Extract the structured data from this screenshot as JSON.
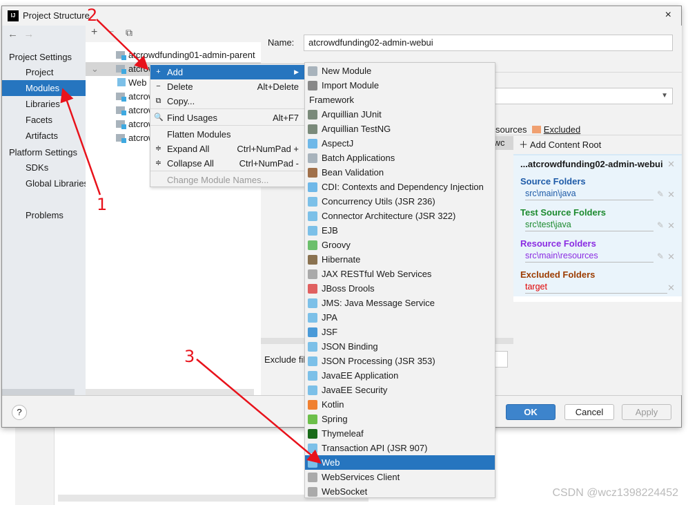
{
  "dialog": {
    "title": "Project Structure",
    "close": "×"
  },
  "sidebar": {
    "back": "←",
    "forward": "→",
    "section1": "Project Settings",
    "items1": [
      "Project",
      "Modules",
      "Libraries",
      "Facets",
      "Artifacts"
    ],
    "section2": "Platform Settings",
    "items2": [
      "SDKs",
      "Global Libraries"
    ],
    "problems": "Problems",
    "selected": "Modules"
  },
  "tree": {
    "toolbar": {
      "add": "+",
      "remove": "−",
      "copy": "⧉"
    },
    "rows": [
      "atcrowdfunding01-admin-parent",
      "atcrowdfunding02-admin-webui",
      "Web",
      "atcrowdfunding03-admin-component",
      "atcrowdfunding04-admin-entity",
      "atcrowdfunding05-common-util",
      "atcrowdfunding06-common-reverse"
    ],
    "row_visible": [
      "atcrowdfunding01-admin-parent",
      "atcrowdfunding02-admin-webui",
      "Web",
      "atcrowdf",
      "atcrowdf",
      "atcrowdf",
      "atcrowdf"
    ]
  },
  "details": {
    "name_label": "Name:",
    "name_value": "atcrowdfunding02-admin-webui",
    "legend_resources": "sources",
    "legend_excluded": "Excluded",
    "tree_partial": "rowc",
    "exclude_label": "Exclude fil"
  },
  "content_root": {
    "add": "Add Content Root",
    "path": "...atcrowdfunding02-admin-webui",
    "source_h": "Source Folders",
    "source_p": "src\\main\\java",
    "test_h": "Test Source Folders",
    "test_p": "src\\test\\java",
    "res_h": "Resource Folders",
    "res_p": "src\\main\\resources",
    "exc_h": "Excluded Folders",
    "exc_p": "target",
    "colors": {
      "source": "#1e5ba8",
      "test": "#1c8a2e",
      "res": "#8a2be2",
      "exc": "#9c3c00",
      "exc_path": "#e00000"
    }
  },
  "context_menu": [
    {
      "label": "Add",
      "shortcut": "",
      "icon": "+",
      "sel": true
    },
    {
      "label": "Delete",
      "shortcut": "Alt+Delete",
      "icon": "−"
    },
    {
      "label": "Copy...",
      "shortcut": "",
      "icon": "⧉"
    },
    {
      "label": "Find Usages",
      "shortcut": "Alt+F7",
      "icon": "🔍"
    },
    {
      "label": "Flatten Modules",
      "shortcut": "",
      "icon": ""
    },
    {
      "label": "Expand All",
      "shortcut": "Ctrl+NumPad +",
      "icon": "≑"
    },
    {
      "label": "Collapse All",
      "shortcut": "Ctrl+NumPad -",
      "icon": "≑"
    },
    {
      "label": "Change Module Names...",
      "shortcut": "",
      "icon": "",
      "disabled": true
    }
  ],
  "submenu": [
    {
      "label": "New Module",
      "color": "#a8b3bc"
    },
    {
      "label": "Import Module",
      "color": "#888"
    },
    {
      "label": "Framework",
      "header": true
    },
    {
      "label": "Arquillian JUnit",
      "color": "#7a8a7a"
    },
    {
      "label": "Arquillian TestNG",
      "color": "#7a8a7a"
    },
    {
      "label": "AspectJ",
      "color": "#6fb8e8"
    },
    {
      "label": "Batch Applications",
      "color": "#a8b3bc"
    },
    {
      "label": "Bean Validation",
      "color": "#a0704a"
    },
    {
      "label": "CDI: Contexts and Dependency Injection",
      "color": "#6fb8e8"
    },
    {
      "label": "Concurrency Utils (JSR 236)",
      "color": "#7cc0e8"
    },
    {
      "label": "Connector Architecture (JSR 322)",
      "color": "#7cc0e8"
    },
    {
      "label": "EJB",
      "color": "#7cc0e8"
    },
    {
      "label": "Groovy",
      "color": "#6cbf6c"
    },
    {
      "label": "Hibernate",
      "color": "#8a7250"
    },
    {
      "label": "JAX RESTful Web Services",
      "color": "#aaa"
    },
    {
      "label": "JBoss Drools",
      "color": "#e06060"
    },
    {
      "label": "JMS: Java Message Service",
      "color": "#7cc0e8"
    },
    {
      "label": "JPA",
      "color": "#7cc0e8"
    },
    {
      "label": "JSF",
      "color": "#4a9ad8"
    },
    {
      "label": "JSON Binding",
      "color": "#7cc0e8"
    },
    {
      "label": "JSON Processing (JSR 353)",
      "color": "#7cc0e8"
    },
    {
      "label": "JavaEE Application",
      "color": "#7cc0e8"
    },
    {
      "label": "JavaEE Security",
      "color": "#7cc0e8"
    },
    {
      "label": "Kotlin",
      "color": "#f08030"
    },
    {
      "label": "Spring",
      "color": "#6cbf4a"
    },
    {
      "label": "Thymeleaf",
      "color": "#1a6b1a"
    },
    {
      "label": "Transaction API (JSR 907)",
      "color": "#7cc0e8"
    },
    {
      "label": "Web",
      "color": "#7cc0e8",
      "sel": true
    },
    {
      "label": "WebServices Client",
      "color": "#aaa"
    },
    {
      "label": "WebSocket",
      "color": "#aaa"
    }
  ],
  "footer": {
    "help": "?",
    "ok": "OK",
    "cancel": "Cancel",
    "apply": "Apply"
  },
  "annotations": [
    "1",
    "2",
    "3"
  ],
  "watermark": "CSDN @wcz1398224452",
  "accent": "#2675bf"
}
